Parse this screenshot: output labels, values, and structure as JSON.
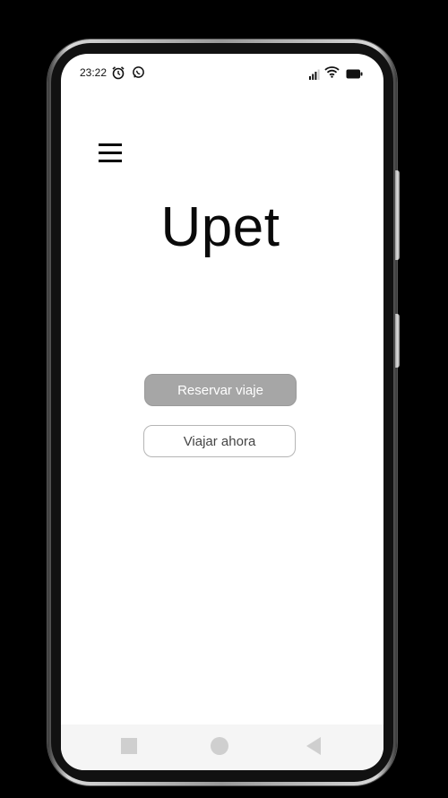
{
  "status_bar": {
    "time": "23:22",
    "left_icons": [
      "alarm-icon",
      "whatsapp-icon"
    ],
    "right_icons": [
      "signal-icon",
      "wifi-icon",
      "battery-icon"
    ]
  },
  "header": {
    "menu_icon": "hamburger-menu-icon"
  },
  "app": {
    "title": "Upet"
  },
  "actions": {
    "book_trip_label": "Reservar viaje",
    "travel_now_label": "Viajar ahora"
  },
  "nav_bar": {
    "icons": [
      "recent-apps-icon",
      "home-icon",
      "back-icon"
    ]
  },
  "colors": {
    "primary_button_bg": "#a6a6a6",
    "secondary_button_border": "#b5b5b5",
    "screen_bg": "#ffffff",
    "nav_bar_bg": "#f5f5f5"
  }
}
